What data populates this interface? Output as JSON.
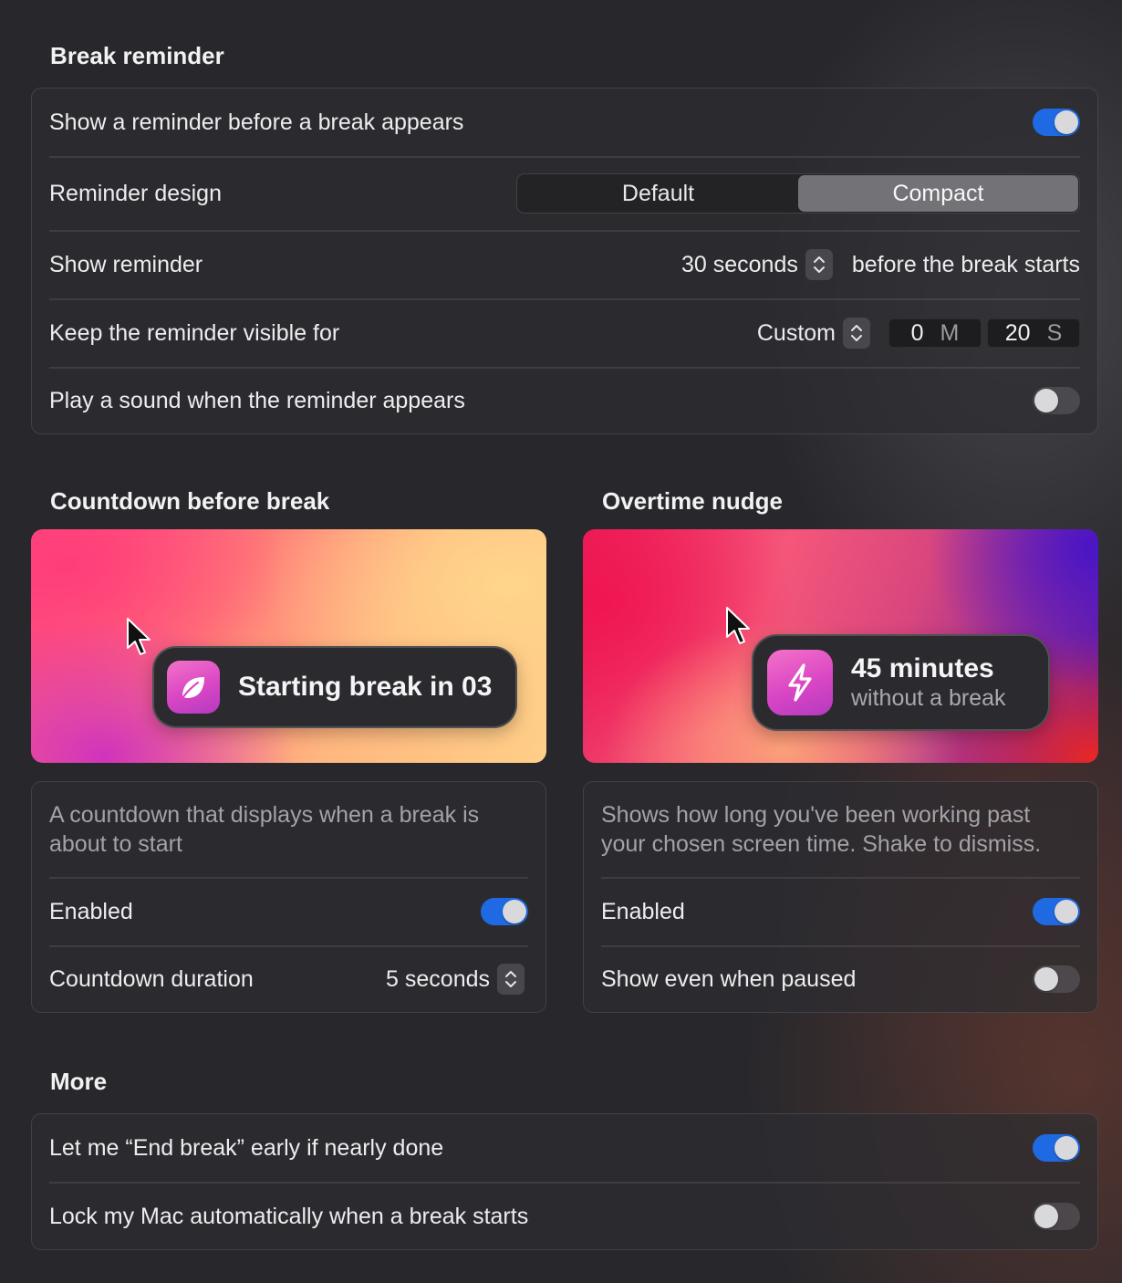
{
  "break_reminder": {
    "title": "Break reminder",
    "show_reminder_toggle": {
      "label": "Show a reminder before a break appears",
      "on": true
    },
    "reminder_design": {
      "label": "Reminder design",
      "options": [
        "Default",
        "Compact"
      ],
      "selected": "Compact"
    },
    "show_reminder": {
      "label": "Show reminder",
      "value": "30 seconds",
      "suffix": "before the break starts"
    },
    "keep_visible": {
      "label": "Keep the reminder visible for",
      "value": "Custom",
      "minutes": "0",
      "minutes_unit": "M",
      "seconds": "20",
      "seconds_unit": "S"
    },
    "play_sound": {
      "label": "Play a sound when the reminder appears",
      "on": false
    }
  },
  "countdown": {
    "title": "Countdown before break",
    "preview_text": "Starting break in 03",
    "description": "A countdown that displays when a break is about to start",
    "enabled": {
      "label": "Enabled",
      "on": true
    },
    "duration": {
      "label": "Countdown duration",
      "value": "5 seconds"
    }
  },
  "overtime": {
    "title": "Overtime nudge",
    "preview_title": "45 minutes",
    "preview_subtitle": "without a break",
    "description": "Shows how long you've been working past your chosen screen time. Shake to dismiss.",
    "enabled": {
      "label": "Enabled",
      "on": true
    },
    "show_when_paused": {
      "label": "Show even when paused",
      "on": false
    }
  },
  "more": {
    "title": "More",
    "end_break_early": {
      "label": "Let me “End break” early if nearly done",
      "on": true
    },
    "lock_mac": {
      "label": "Lock my Mac automatically when a break starts",
      "on": false
    }
  },
  "colors": {
    "accent": "#1f6ae3",
    "background": "#28282c",
    "app_icon": "#d946c4"
  },
  "icons": [
    "leaf-icon",
    "lightning-icon",
    "cursor-icon",
    "stepper-chevrons-icon"
  ]
}
